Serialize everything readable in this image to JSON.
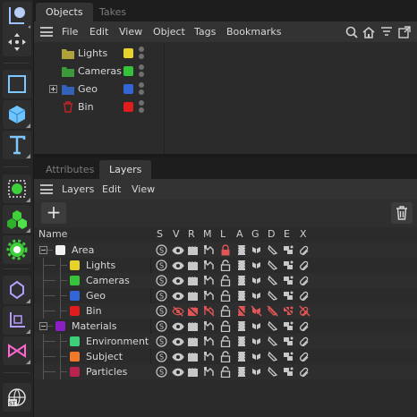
{
  "objects_panel": {
    "tabs": [
      "Objects",
      "Takes"
    ],
    "menu": [
      "File",
      "Edit",
      "View",
      "Object",
      "Tags",
      "Bookmarks"
    ],
    "items": [
      {
        "label": "Lights",
        "folder_color": "#b0a23a",
        "tag_color": "#e6d22c"
      },
      {
        "label": "Cameras",
        "folder_color": "#3c9a3c",
        "tag_color": "#36c23a"
      },
      {
        "label": "Geo",
        "folder_color": "#3360b8",
        "tag_color": "#3266d6"
      },
      {
        "label": "Bin",
        "folder_color": "#b02020",
        "tag_color": "#e01c1c"
      }
    ],
    "toolbar_icons": [
      "search-icon",
      "home-icon",
      "filter-icon",
      "expand-icon"
    ]
  },
  "layers_panel": {
    "tabs": [
      "Attributes",
      "Layers"
    ],
    "menu": [
      "Layers",
      "Edit",
      "View"
    ],
    "add_label": "+",
    "header": {
      "name": "Name",
      "columns": [
        "S",
        "V",
        "R",
        "M",
        "L",
        "A",
        "G",
        "D",
        "E",
        "X"
      ]
    },
    "layers": [
      {
        "name": "Area",
        "color": "#f2f2f2",
        "level": 0,
        "expanded": true,
        "locked": true
      },
      {
        "name": "Lights",
        "color": "#e6d22c",
        "level": 1
      },
      {
        "name": "Cameras",
        "color": "#36c23a",
        "level": 1
      },
      {
        "name": "Geo",
        "color": "#3266d6",
        "level": 1
      },
      {
        "name": "Bin",
        "color": "#e01c1c",
        "level": 1,
        "disabled": true
      },
      {
        "name": "Materials",
        "color": "#8a1fc4",
        "level": 0,
        "expanded": true
      },
      {
        "name": "Environment",
        "color": "#3ccf7a",
        "level": 1
      },
      {
        "name": "Subject",
        "color": "#f07a2a",
        "level": 1
      },
      {
        "name": "Particles",
        "color": "#b8244e",
        "level": 1
      }
    ]
  },
  "colors": {
    "accent_disabled": "#e05555"
  }
}
